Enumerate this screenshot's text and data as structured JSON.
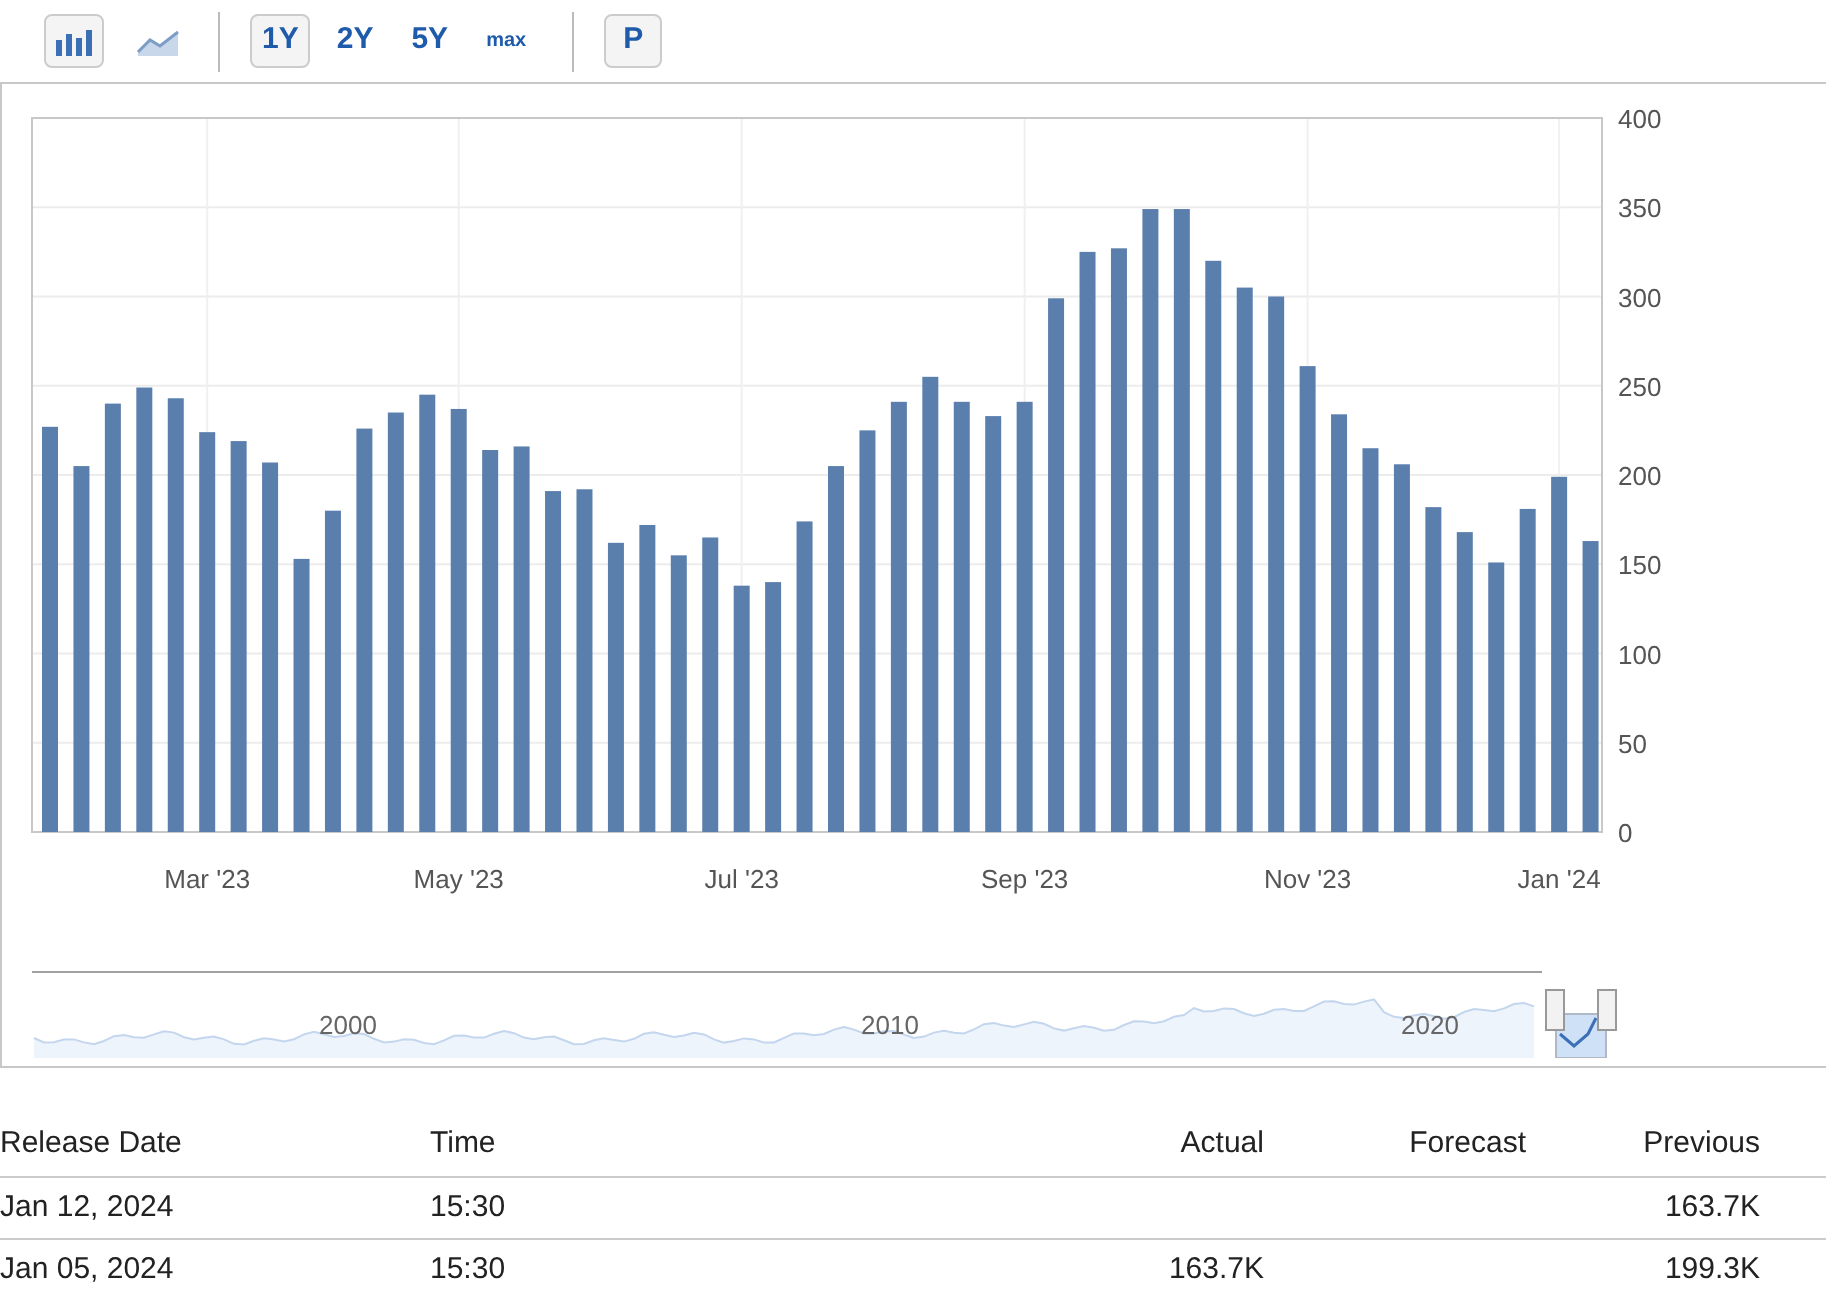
{
  "toolbar": {
    "chart_types": [
      {
        "kind": "bar",
        "selected": true
      },
      {
        "kind": "line",
        "selected": false
      }
    ],
    "ranges": [
      {
        "label": "1Y",
        "selected": true
      },
      {
        "label": "2Y",
        "selected": false
      },
      {
        "label": "5Y",
        "selected": false
      },
      {
        "label": "max",
        "selected": false
      }
    ],
    "p_button": "P"
  },
  "chart": {
    "chart_data": {
      "type": "bar",
      "categories": [
        null,
        null,
        null,
        null,
        null,
        "Mar '23",
        null,
        null,
        null,
        null,
        null,
        null,
        null,
        "May '23",
        null,
        null,
        null,
        null,
        null,
        null,
        null,
        null,
        "Jul '23",
        null,
        null,
        null,
        null,
        null,
        null,
        null,
        null,
        "Sep '23",
        null,
        null,
        null,
        null,
        null,
        null,
        null,
        null,
        "Nov '23",
        null,
        null,
        null,
        null,
        null,
        null,
        null,
        "Jan '24",
        null
      ],
      "series": [
        {
          "color": "#5b7fad",
          "values": [
            227,
            205,
            240,
            249,
            243,
            224,
            219,
            207,
            153,
            180,
            226,
            235,
            245,
            237,
            214,
            216,
            191,
            192,
            162,
            172,
            155,
            165,
            138,
            140,
            174,
            205,
            225,
            241,
            255,
            241,
            233,
            241,
            299,
            325,
            327,
            349,
            349,
            320,
            305,
            300,
            261,
            234,
            215,
            206,
            182,
            168,
            151,
            181,
            199,
            163
          ]
        }
      ],
      "grid": true,
      "ylim": [
        0,
        400
      ],
      "yticks": [
        0,
        50,
        100,
        150,
        200,
        250,
        300,
        350,
        400
      ]
    }
  },
  "navigator": {
    "labels": [
      "2000",
      "2010",
      "2020"
    ]
  },
  "table": {
    "columns": [
      "Release Date",
      "Time",
      "Actual",
      "Forecast",
      "Previous"
    ],
    "rows": [
      [
        "Jan 12, 2024",
        "15:30",
        "",
        "",
        "163.7K"
      ],
      [
        "Jan 05, 2024",
        "15:30",
        "163.7K",
        "",
        "199.3K"
      ]
    ]
  }
}
